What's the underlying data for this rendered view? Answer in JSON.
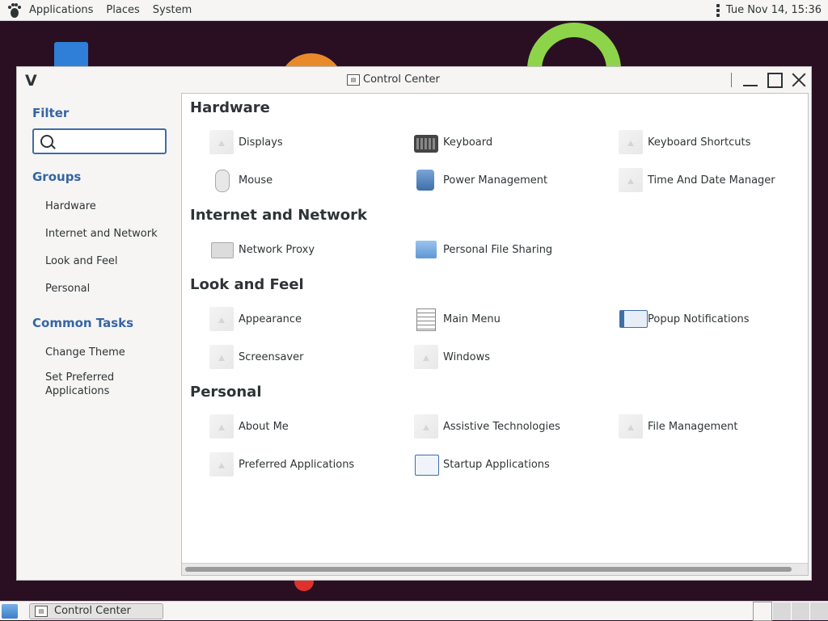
{
  "top_panel": {
    "menus": [
      "Applications",
      "Places",
      "System"
    ],
    "clock": "Tue Nov 14, 15:36"
  },
  "window": {
    "title": "Control Center",
    "app_letter": "V"
  },
  "sidebar": {
    "filter_heading": "Filter",
    "search_placeholder": "",
    "groups_heading": "Groups",
    "groups": [
      "Hardware",
      "Internet and Network",
      "Look and Feel",
      "Personal"
    ],
    "tasks_heading": "Common Tasks",
    "tasks": [
      "Change Theme",
      "Set Preferred Applications"
    ]
  },
  "sections": [
    {
      "title": "Hardware",
      "items": [
        {
          "label": "Displays",
          "icon": "displays-icon"
        },
        {
          "label": "Keyboard",
          "icon": "keyboard-icon"
        },
        {
          "label": "Keyboard Shortcuts",
          "icon": "keyboard-shortcuts-icon"
        },
        {
          "label": "Mouse",
          "icon": "mouse-icon"
        },
        {
          "label": "Power Management",
          "icon": "power-management-icon"
        },
        {
          "label": "Time And Date Manager",
          "icon": "time-date-icon"
        }
      ]
    },
    {
      "title": "Internet and Network",
      "items": [
        {
          "label": "Network Proxy",
          "icon": "network-proxy-icon"
        },
        {
          "label": "Personal File Sharing",
          "icon": "folder-share-icon"
        }
      ]
    },
    {
      "title": "Look and Feel",
      "items": [
        {
          "label": "Appearance",
          "icon": "appearance-icon"
        },
        {
          "label": "Main Menu",
          "icon": "main-menu-icon"
        },
        {
          "label": "Popup Notifications",
          "icon": "popup-notifications-icon"
        },
        {
          "label": "Screensaver",
          "icon": "screensaver-icon"
        },
        {
          "label": "Windows",
          "icon": "windows-icon"
        }
      ]
    },
    {
      "title": "Personal",
      "items": [
        {
          "label": "About Me",
          "icon": "about-me-icon"
        },
        {
          "label": "Assistive Technologies",
          "icon": "assistive-technologies-icon"
        },
        {
          "label": "File Management",
          "icon": "file-management-icon"
        },
        {
          "label": "Preferred Applications",
          "icon": "preferred-applications-icon"
        },
        {
          "label": "Startup Applications",
          "icon": "startup-applications-icon"
        }
      ]
    }
  ],
  "taskbar": {
    "task_label": "Control Center"
  },
  "colors": {
    "accent": "#3465a4",
    "desktop": "#2a0f22"
  }
}
